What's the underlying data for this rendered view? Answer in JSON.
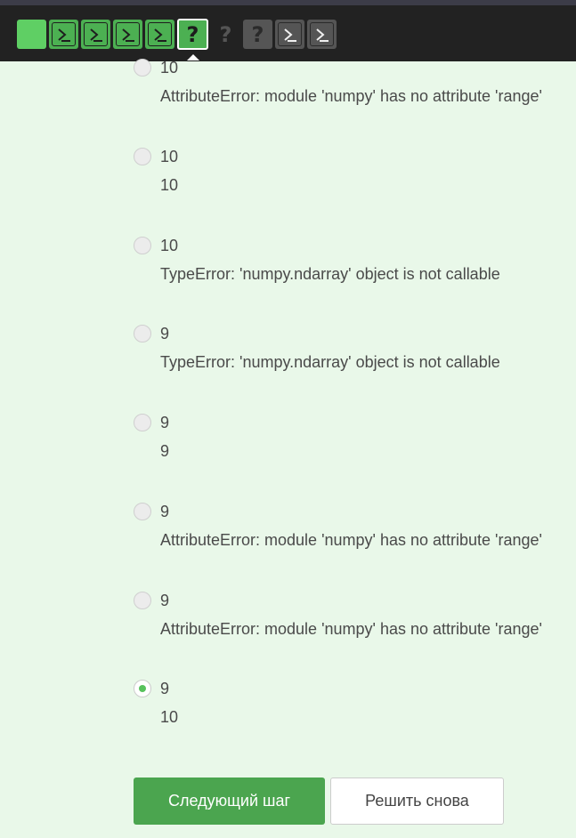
{
  "steps": [
    {
      "type": "text",
      "state": "done"
    },
    {
      "type": "code",
      "state": "done"
    },
    {
      "type": "code",
      "state": "done"
    },
    {
      "type": "code",
      "state": "done"
    },
    {
      "type": "code",
      "state": "done"
    },
    {
      "type": "quiz",
      "state": "current",
      "glyph": "?"
    },
    {
      "type": "quiz",
      "state": "todo",
      "glyph": "?"
    },
    {
      "type": "quiz",
      "state": "todo",
      "glyph": "?"
    },
    {
      "type": "code",
      "state": "todo"
    },
    {
      "type": "code",
      "state": "todo"
    }
  ],
  "options": [
    {
      "line1": "10",
      "line2": "AttributeError: module 'numpy' has no attribute 'range'",
      "checked": false
    },
    {
      "line1": "10",
      "line2": "10",
      "checked": false
    },
    {
      "line1": "10",
      "line2": "TypeError: 'numpy.ndarray' object is not callable",
      "checked": false
    },
    {
      "line1": "9",
      "line2": "TypeError: 'numpy.ndarray' object is not callable",
      "checked": false
    },
    {
      "line1": "9",
      "line2": "9",
      "checked": false
    },
    {
      "line1": "9",
      "line2": "AttributeError: module 'numpy' has no attribute 'range'",
      "checked": false
    },
    {
      "line1": "9",
      "line2": "AttributeError: module 'numpy' has no attribute 'range'",
      "checked": false
    },
    {
      "line1": "9",
      "line2": "10",
      "checked": true
    }
  ],
  "buttons": {
    "next_label": "Следующий шаг",
    "retry_label": "Решить снова"
  },
  "colors": {
    "accent": "#4ba54f",
    "background": "#e9f8e9",
    "header": "#222222"
  }
}
